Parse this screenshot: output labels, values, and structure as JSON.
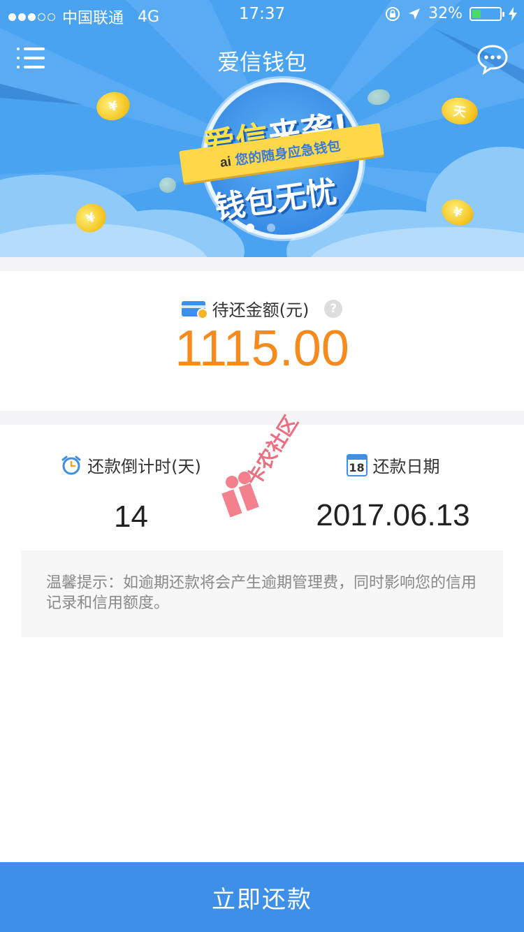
{
  "status_bar": {
    "carrier": "中国联通",
    "network": "4G",
    "time": "17:37",
    "battery": "32%",
    "battery_level": 0.32
  },
  "nav": {
    "title": "爱信钱包",
    "menu_icon": "menu-icon",
    "chat_icon": "chat-bubble-icon"
  },
  "banner": {
    "slogan_line1_a": "爱信",
    "slogan_line1_b": "来袭!",
    "tagline": "您的随身应急钱包",
    "slogan_line2": "钱包无忧",
    "logo_text": "ai",
    "coin_symbol": "¥",
    "coin_symbol_alt": "天",
    "active_slide": 1,
    "slide_count": 2
  },
  "amount": {
    "label": "待还金额(元)",
    "help": "?",
    "value": "1115.00"
  },
  "repayment": {
    "countdown_label": "还款倒计时(天)",
    "countdown_value": "14",
    "date_label": "还款日期",
    "date_value": "2017.06.13",
    "calendar_day": "18"
  },
  "watermark": {
    "text": "卡农社区"
  },
  "tip": {
    "text": "温馨提示：如逾期还款将会产生逾期管理费，同时影响您的信用记录和信用额度。"
  },
  "action": {
    "repay_label": "立即还款"
  },
  "colors": {
    "primary": "#3d8fe8",
    "banner": "#4aa3f0",
    "amount": "#f78a1d",
    "coin": "#f3c21d"
  }
}
